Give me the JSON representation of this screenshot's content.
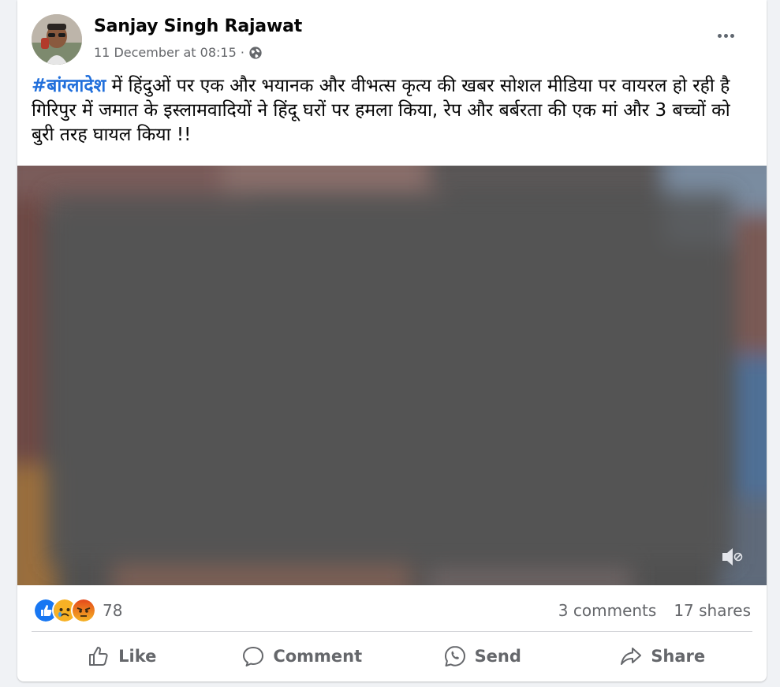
{
  "post": {
    "author": "Sanjay Singh Rajawat",
    "date": "11 December at 08:15 ·",
    "privacy_icon": "globe-icon",
    "hashtag": "#बांग्लादेश",
    "body": " में हिंदुओं पर एक और भयानक और वीभत्स कृत्य की खबर सोशल मीडिया पर वायरल हो रही है गिरिपुर में जमात के इस्लामवादियों ने हिंदू घरों पर हमला किया, रेप और बर्बरता की एक मां और 3 बच्चों को बुरी तरह घायल किया !!"
  },
  "video": {
    "muted": true,
    "mute_icon": "speaker-muted-icon"
  },
  "engagement": {
    "reaction_icons": [
      "like-icon",
      "sad-icon",
      "angry-icon"
    ],
    "reaction_count": "78",
    "comments": "3 comments",
    "shares": "17 shares"
  },
  "actions": {
    "like": "Like",
    "comment": "Comment",
    "send": "Send",
    "share": "Share"
  },
  "colors": {
    "link": "#216fdb",
    "muted_text": "#65676b",
    "like_blue": "#1877f2",
    "angry_red": "#e9710f"
  }
}
